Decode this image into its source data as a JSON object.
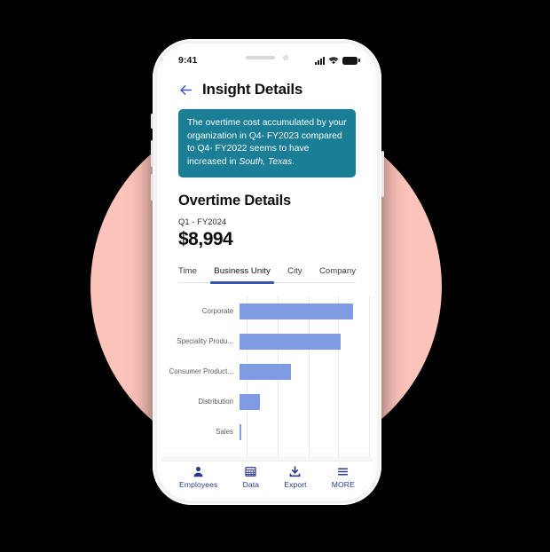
{
  "status_bar": {
    "time": "9:41",
    "signal_icon": "signal-bars-icon",
    "wifi_icon": "wifi-icon",
    "battery_icon": "battery-icon"
  },
  "header": {
    "back_icon": "back-arrow-icon",
    "title": "Insight Details"
  },
  "insight_card": {
    "text_part1": "The overtime cost accumulated by your organization in Q4- FY2023 compared to Q4- FY2022 seems to have increased in ",
    "location": "South, Texas",
    "text_part2": ".",
    "background_color": "#1a7e96"
  },
  "overtime": {
    "title": "Overtime Details",
    "period": "Q1 - FY2024",
    "amount": "$8,994"
  },
  "tabs": {
    "items": [
      {
        "label": "Time",
        "active": false
      },
      {
        "label": "Business Unity",
        "active": true
      },
      {
        "label": "City",
        "active": false
      },
      {
        "label": "Company",
        "active": false
      }
    ],
    "active_underline_color": "#3355b8"
  },
  "chart_data": {
    "type": "bar",
    "orientation": "horizontal",
    "title": "",
    "xlabel": "",
    "ylabel": "",
    "categories": [
      "Corporate",
      "Speciality Produ...",
      "Consumer Product...",
      "Distribution",
      "Sales"
    ],
    "values": [
      118,
      105,
      54,
      21,
      2
    ],
    "xlim": [
      0,
      135
    ],
    "grid": true,
    "gridline_values": [
      0,
      34,
      68,
      101,
      135
    ],
    "legend": "none",
    "bar_color": "#7f9ce3"
  },
  "bottom_nav": {
    "items": [
      {
        "label": "Employees",
        "icon": "person-icon"
      },
      {
        "label": "Data",
        "icon": "grid-table-icon"
      },
      {
        "label": "Export",
        "icon": "download-icon"
      },
      {
        "label": "MORE",
        "icon": "hamburger-menu-icon"
      }
    ],
    "color": "#2b3a8f"
  }
}
